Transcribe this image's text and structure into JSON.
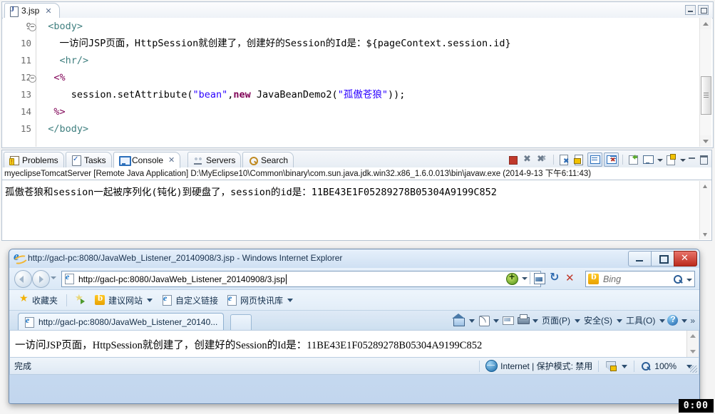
{
  "eclipse": {
    "editor_tab": {
      "label": "3.jsp",
      "icon": "jsp-file-icon",
      "close": "✕"
    },
    "window_controls": {
      "minimize": "minimize-icon",
      "maximize": "maximize-icon"
    },
    "code_lines": [
      {
        "num": "9",
        "fold": true,
        "segments": [
          {
            "t": "  ",
            "c": "plain"
          },
          {
            "t": "<body>",
            "c": "tag"
          }
        ]
      },
      {
        "num": "10",
        "fold": false,
        "segments": [
          {
            "t": "    一访问JSP页面，HttpSession就创建了，创建好的Session的Id是：",
            "c": "plain"
          },
          {
            "t": "${pageContext.session.id}",
            "c": "el"
          }
        ]
      },
      {
        "num": "11",
        "fold": false,
        "segments": [
          {
            "t": "    ",
            "c": "plain"
          },
          {
            "t": "<hr/>",
            "c": "tag"
          }
        ]
      },
      {
        "num": "12",
        "fold": true,
        "segments": [
          {
            "t": "   ",
            "c": "plain"
          },
          {
            "t": "<%",
            "c": "pct"
          }
        ]
      },
      {
        "num": "13",
        "fold": false,
        "segments": [
          {
            "t": "      session.setAttribute(",
            "c": "plain"
          },
          {
            "t": "\"bean\"",
            "c": "str"
          },
          {
            "t": ",",
            "c": "plain"
          },
          {
            "t": "new",
            "c": "kw"
          },
          {
            "t": " JavaBeanDemo2(",
            "c": "plain"
          },
          {
            "t": "\"孤傲苍狼\"",
            "c": "str"
          },
          {
            "t": "));",
            "c": "plain"
          }
        ]
      },
      {
        "num": "14",
        "fold": false,
        "segments": [
          {
            "t": "   ",
            "c": "plain"
          },
          {
            "t": "%>",
            "c": "pct"
          }
        ]
      },
      {
        "num": "15",
        "fold": false,
        "segments": [
          {
            "t": "  ",
            "c": "plain"
          },
          {
            "t": "</body>",
            "c": "tag"
          }
        ]
      }
    ],
    "view_tabs": [
      {
        "label": "Problems",
        "icon": "problems-icon",
        "active": false,
        "closable": false
      },
      {
        "label": "Tasks",
        "icon": "tasks-icon",
        "active": false,
        "closable": false
      },
      {
        "label": "Console",
        "icon": "console-icon",
        "active": true,
        "closable": true,
        "close": "✕"
      },
      {
        "label": "Servers",
        "icon": "servers-icon",
        "active": false,
        "closable": false
      },
      {
        "label": "Search",
        "icon": "search-icon",
        "active": false,
        "closable": false
      }
    ],
    "console_toolbar": [
      "terminate-icon",
      "remove-launch-icon",
      "remove-all-terminated-icon",
      "clear-console-icon",
      "scroll-lock-icon",
      "show-console-on-output-icon",
      "show-console-on-error-icon",
      "pin-console-icon",
      "display-selected-console-icon",
      "display-selected-console-caret",
      "open-console-icon",
      "open-console-caret",
      "view-minimize-icon",
      "view-maximize-icon"
    ],
    "console_launch_line": "myeclipseTomcatServer [Remote Java Application] D:\\MyEclipse10\\Common\\binary\\com.sun.java.jdk.win32.x86_1.6.0.013\\bin\\javaw.exe (2014-9-13 下午6:11:43)",
    "console_output": "孤傲苍狼和session一起被序列化(钝化)到硬盘了，session的id是：11BE43E1F05289278B05304A9199C852"
  },
  "browser": {
    "title": "http://gacl-pc:8080/JavaWeb_Listener_20140908/3.jsp - Windows Internet Explorer",
    "window_controls": {
      "minimize": "minimize-icon",
      "restore": "restore-icon",
      "close": "close-icon"
    },
    "nav": {
      "back": "back-icon",
      "forward": "forward-icon",
      "recent_pages_caret": "chevron-down-icon",
      "address_value": "http://gacl-pc:8080/JavaWeb_Listener_20140908/3.jsp",
      "address_icon": "page-favicon",
      "accelerator_icon": "accelerator-icon",
      "accelerator_caret": "chevron-down-icon",
      "compatibility_icon": "compatibility-view-icon",
      "refresh_icon": "refresh-icon",
      "stop_icon": "stop-icon",
      "search_placeholder": "Bing",
      "search_engine_icon": "bing-icon",
      "search_go_icon": "search-icon",
      "search_caret": "chevron-down-icon"
    },
    "favorites_bar": [
      {
        "label": "收藏夹",
        "icon": "star-icon"
      },
      {
        "label": "",
        "icon": "add-to-favorites-icon"
      },
      {
        "label": "建议网站",
        "icon": "bing-icon",
        "caret": true
      },
      {
        "label": "自定义链接",
        "icon": "page-icon",
        "caret": false
      },
      {
        "label": "网页快讯库",
        "icon": "page-icon",
        "caret": true
      }
    ],
    "tab": {
      "label": "http://gacl-pc:8080/JavaWeb_Listener_20140...",
      "icon": "ie-favicon"
    },
    "new_tab": "new-tab-button",
    "command_bar": {
      "home": "home-icon",
      "home_caret": "chevron-down-icon",
      "feeds": "rss-icon",
      "feeds_caret": "chevron-down-icon",
      "mail": "mail-icon",
      "print": "print-icon",
      "print_caret": "chevron-down-icon",
      "page_menu": "页面(P)",
      "safety_menu": "安全(S)",
      "tools_menu": "工具(O)",
      "help_icon": "help-icon",
      "help_caret": "chevron-down-icon",
      "overflow": "»"
    },
    "page_content": "一访问JSP页面，HttpSession就创建了，创建好的Session的Id是：11BE43E1F05289278B05304A9199C852",
    "status": {
      "text": "完成",
      "zone_icon": "internet-zone-icon",
      "zone_label": "Internet | 保护模式: 禁用",
      "privacy_icon": "privacy-shield-icon",
      "privacy_caret": "chevron-down-icon",
      "zoom_icon": "zoom-icon",
      "zoom_level": "100%",
      "zoom_caret": "chevron-down-icon"
    }
  },
  "overlay": {
    "timer": "0:00"
  }
}
